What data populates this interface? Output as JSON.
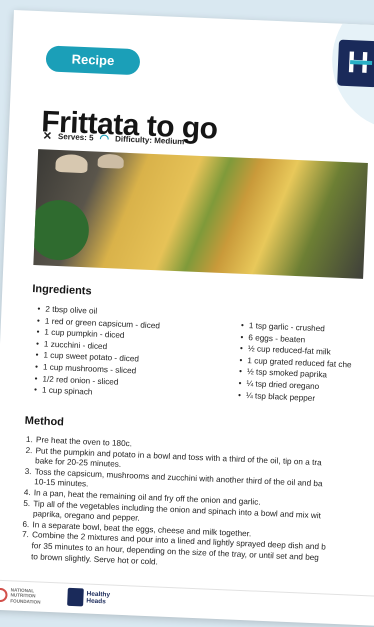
{
  "badge": "Recipe",
  "title": "Frittata to go",
  "meta": {
    "serves": "Serves: 5",
    "difficulty": "Difficulty: Medium"
  },
  "ingredients": {
    "heading": "Ingredients",
    "left": [
      "2 tbsp olive oil",
      "1 red or green capsicum - diced",
      "1 cup pumpkin - diced",
      "1 zucchini - diced",
      "1 cup sweet potato - diced",
      "1 cup mushrooms - sliced",
      "1/2 red onion - sliced",
      "1 cup spinach"
    ],
    "right": [
      "1 tsp garlic - crushed",
      "6 eggs - beaten",
      "½ cup reduced-fat milk",
      "1 cup grated reduced fat che",
      "½ tsp smoked paprika",
      "¼ tsp dried oregano",
      "¼ tsp black pepper"
    ]
  },
  "method": {
    "heading": "Method",
    "steps": [
      {
        "n": "1.",
        "text": "Pre heat the oven to 180c."
      },
      {
        "n": "2.",
        "text": "Put the pumpkin and potato in a bowl and toss with a third of the oil, tip on a tra\nbake for 20-25 minutes."
      },
      {
        "n": "3.",
        "text": "Toss the capsicum, mushrooms and zucchini with another third of the oil and ba\n10-15 minutes."
      },
      {
        "n": "4.",
        "text": "In a pan, heat the remaining oil and fry off the onion and garlic."
      },
      {
        "n": "5.",
        "text": "Tip all of the vegetables including the onion and spinach into a bowl and mix wit\npaprika, oregano and pepper."
      },
      {
        "n": "6.",
        "text": "In a separate bowl, beat the eggs, cheese and milk together."
      },
      {
        "n": "7.",
        "text": "Combine the 2 mixtures and pour into a lined and lightly sprayed deep dish and b\nfor 35 minutes to an hour, depending on the size of the tray, or until set and beg\nto brown slightly. Serve hot or cold."
      }
    ]
  },
  "footer": {
    "nnf": "NATIONAL\nNUTRITION\nFOUNDATION",
    "hh": "Healthy\nHeads"
  },
  "colors": {
    "accent": "#1b9fb8",
    "navy": "#1a2a5a"
  },
  "icons": {
    "serves": "utensils-icon",
    "difficulty": "gauge-icon"
  }
}
